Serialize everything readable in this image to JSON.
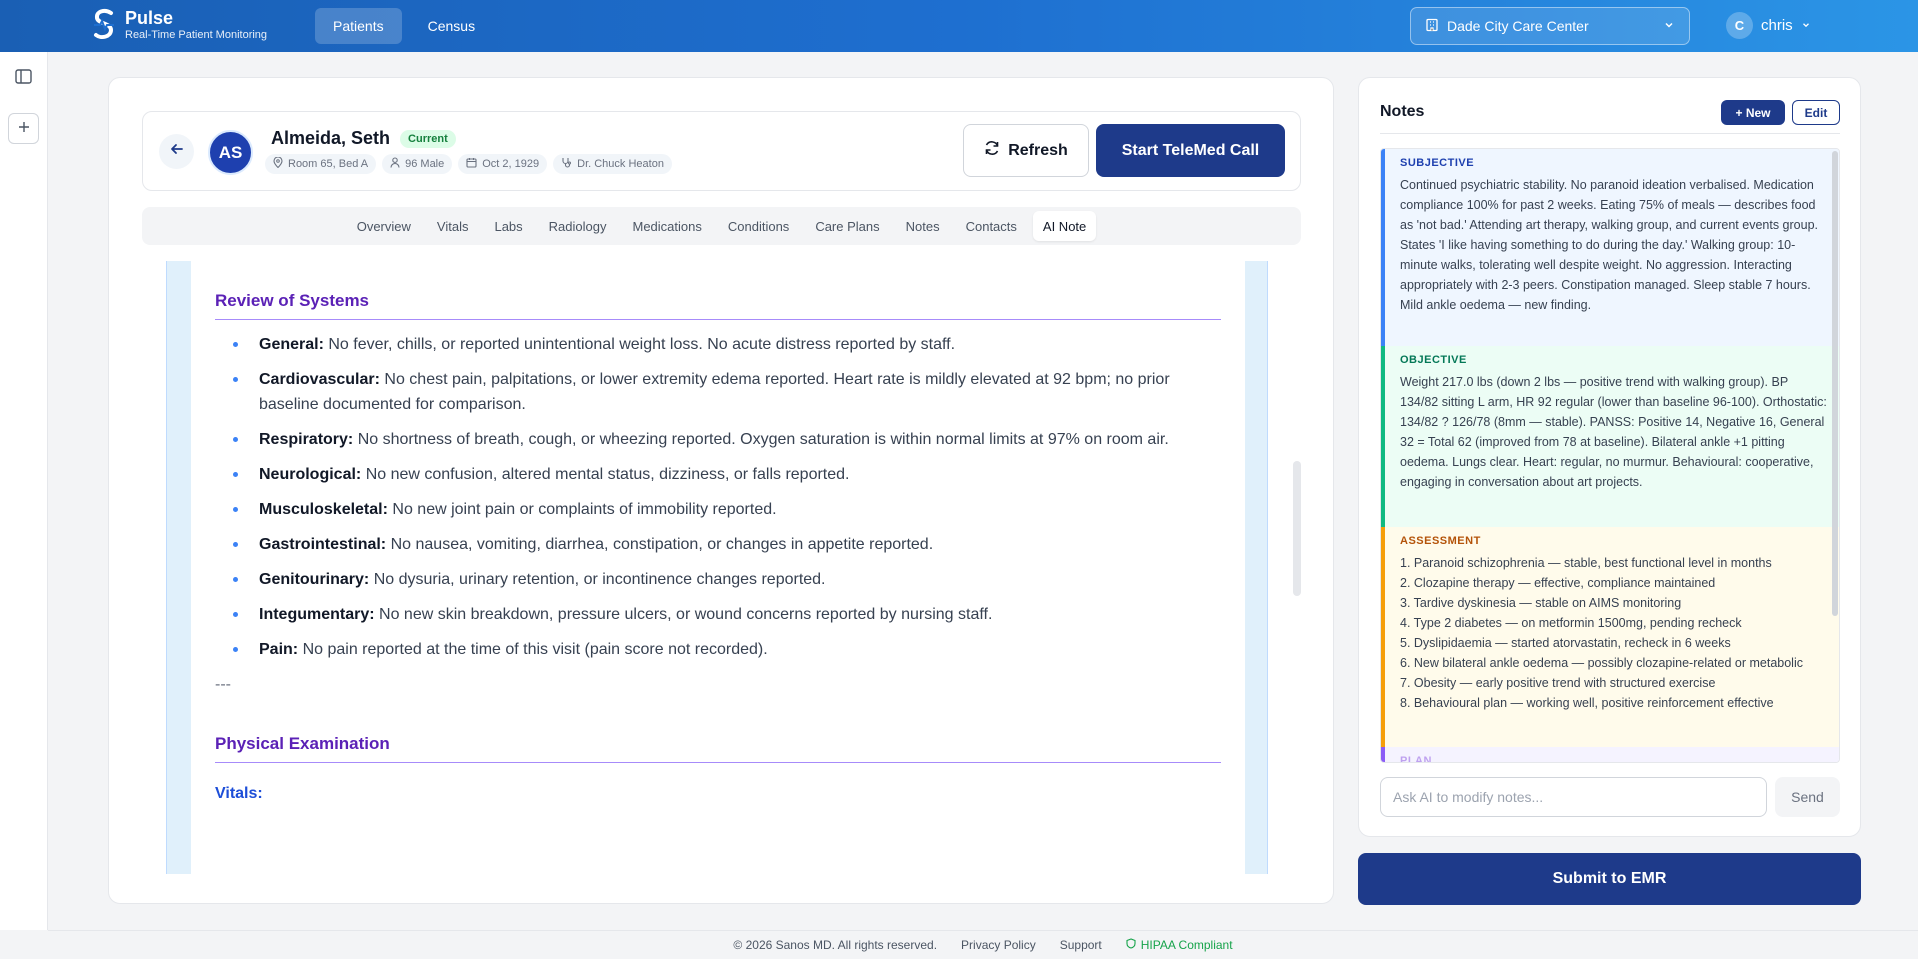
{
  "app": {
    "name": "Pulse",
    "subtitle": "Real-Time Patient Monitoring"
  },
  "nav": {
    "patients": "Patients",
    "census": "Census"
  },
  "facility": {
    "selected": "Dade City Care Center"
  },
  "user": {
    "initial": "C",
    "name": "chris"
  },
  "patient": {
    "initials": "AS",
    "name": "Almeida, Seth",
    "status": "Current",
    "room": "Room 65, Bed A",
    "age_sex": "96 Male",
    "dob": "Oct 2, 1929",
    "physician": "Dr. Chuck Heaton"
  },
  "actions": {
    "refresh": "Refresh",
    "telemed": "Start TeleMed Call"
  },
  "tabs": [
    "Overview",
    "Vitals",
    "Labs",
    "Radiology",
    "Medications",
    "Conditions",
    "Care Plans",
    "Notes",
    "Contacts",
    "AI Note"
  ],
  "note": {
    "ros_title": "Review of Systems",
    "ros": [
      {
        "label": "General:",
        "text": "No fever, chills, or reported unintentional weight loss. No acute distress reported by staff."
      },
      {
        "label": "Cardiovascular:",
        "text": "No chest pain, palpitations, or lower extremity edema reported. Heart rate is mildly elevated at 92 bpm; no prior baseline documented for comparison."
      },
      {
        "label": "Respiratory:",
        "text": "No shortness of breath, cough, or wheezing reported. Oxygen saturation is within normal limits at 97% on room air."
      },
      {
        "label": "Neurological:",
        "text": "No new confusion, altered mental status, dizziness, or falls reported."
      },
      {
        "label": "Musculoskeletal:",
        "text": "No new joint pain or complaints of immobility reported."
      },
      {
        "label": "Gastrointestinal:",
        "text": "No nausea, vomiting, diarrhea, constipation, or changes in appetite reported."
      },
      {
        "label": "Genitourinary:",
        "text": "No dysuria, urinary retention, or incontinence changes reported."
      },
      {
        "label": "Integumentary:",
        "text": "No new skin breakdown, pressure ulcers, or wound concerns reported by nursing staff."
      },
      {
        "label": "Pain:",
        "text": "No pain reported at the time of this visit (pain score not recorded)."
      }
    ],
    "separator": "---",
    "pe_title": "Physical Examination",
    "vitals_title": "Vitals:"
  },
  "notes_panel": {
    "title": "Notes",
    "new_label": "+ New",
    "edit_label": "Edit",
    "subjective_label": "SUBJECTIVE",
    "subjective": "Continued psychiatric stability. No paranoid ideation verbalised. Medication compliance 100% for past 2 weeks. Eating 75% of meals — describes food as 'not bad.' Attending art therapy, walking group, and current events group. States 'I like having something to do during the day.' Walking group: 10-minute walks, tolerating well despite weight. No aggression. Interacting appropriately with 2-3 peers. Constipation managed. Sleep stable 7 hours. Mild ankle oedema — new finding.",
    "objective_label": "OBJECTIVE",
    "objective": "Weight 217.0 lbs (down 2 lbs — positive trend with walking group). BP 134/82 sitting L arm, HR 92 regular (lower than baseline 96-100). Orthostatic: 134/82 ? 126/78 (8mm — stable). PANSS: Positive 14, Negative 16, General 32 = Total 62 (improved from 78 at baseline). Bilateral ankle +1 pitting oedema. Lungs clear. Heart: regular, no murmur. Behavioural: cooperative, engaging in conversation about art projects.",
    "assessment_label": "ASSESSMENT",
    "assessment": [
      "1. Paranoid schizophrenia — stable, best functional level in months",
      "2. Clozapine therapy — effective, compliance maintained",
      "3. Tardive dyskinesia — stable on AIMS monitoring",
      "4. Type 2 diabetes — on metformin 1500mg, pending recheck",
      "5. Dyslipidaemia — started atorvastatin, recheck in 6 weeks",
      "6. New bilateral ankle oedema — possibly clozapine-related or metabolic",
      "7. Obesity — early positive trend with structured exercise",
      "8. Behavioural plan — working well, positive reinforcement effective"
    ],
    "plan_label": "PLAN",
    "ai_placeholder": "Ask AI to modify notes...",
    "send_label": "Send",
    "submit_label": "Submit to EMR"
  },
  "footer": {
    "copyright": "© 2026 Sanos MD. All rights reserved.",
    "privacy": "Privacy Policy",
    "support": "Support",
    "hipaa": "HIPAA Compliant"
  }
}
